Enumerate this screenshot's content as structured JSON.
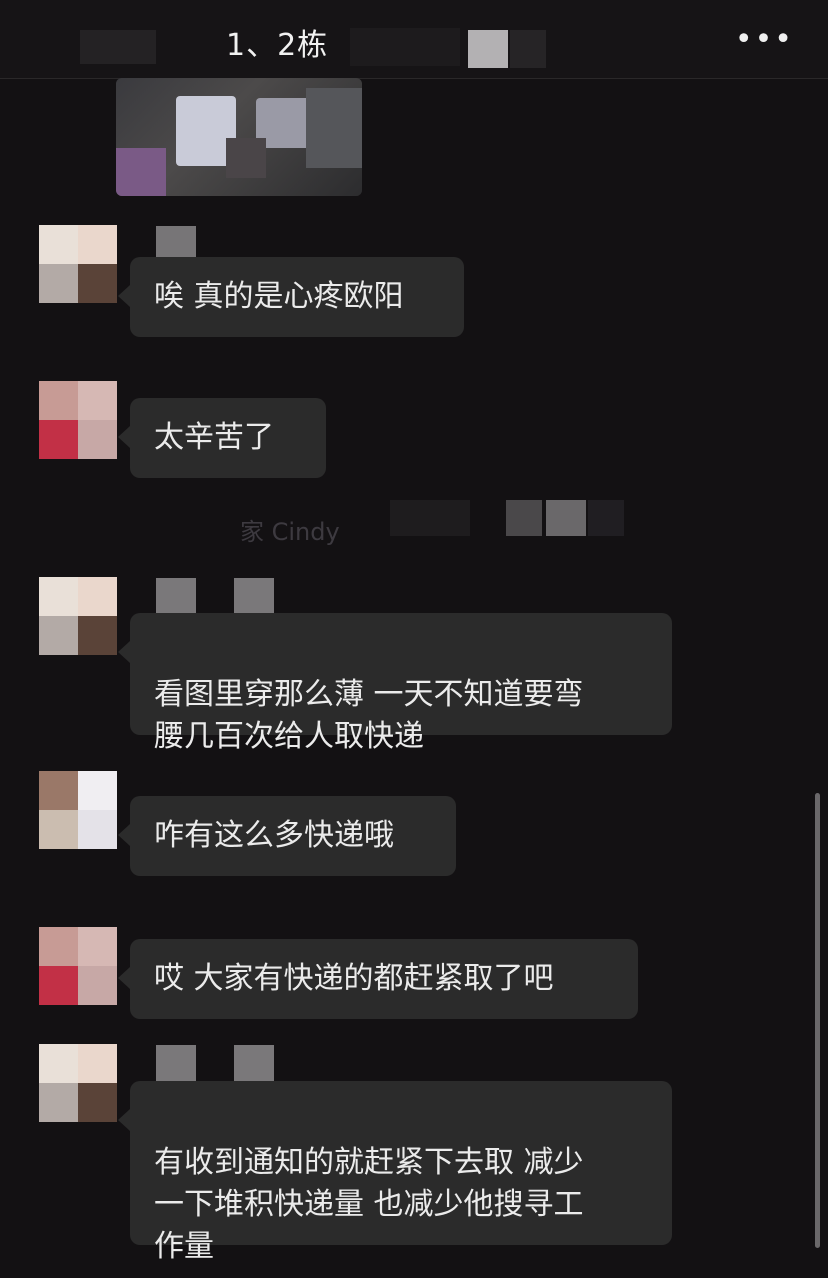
{
  "header": {
    "title": "1、2栋",
    "more_label": "•••"
  },
  "system_text": "家 Cindy",
  "messages": [
    {
      "text": "唉 真的是心疼欧阳"
    },
    {
      "text": "太辛苦了"
    },
    {
      "text": "看图里穿那么薄 一天不知道要弯\n腰几百次给人取快递"
    },
    {
      "text": "咋有这么多快递哦"
    },
    {
      "text": "哎 大家有快递的都赶紧取了吧"
    },
    {
      "text": "有收到通知的就赶紧下去取 减少\n一下堆积快递量 也减少他搜寻工\n作量"
    }
  ],
  "colors": {
    "background": "#131113",
    "bubble": "#2b2b2b",
    "text": "#ebebeb"
  }
}
